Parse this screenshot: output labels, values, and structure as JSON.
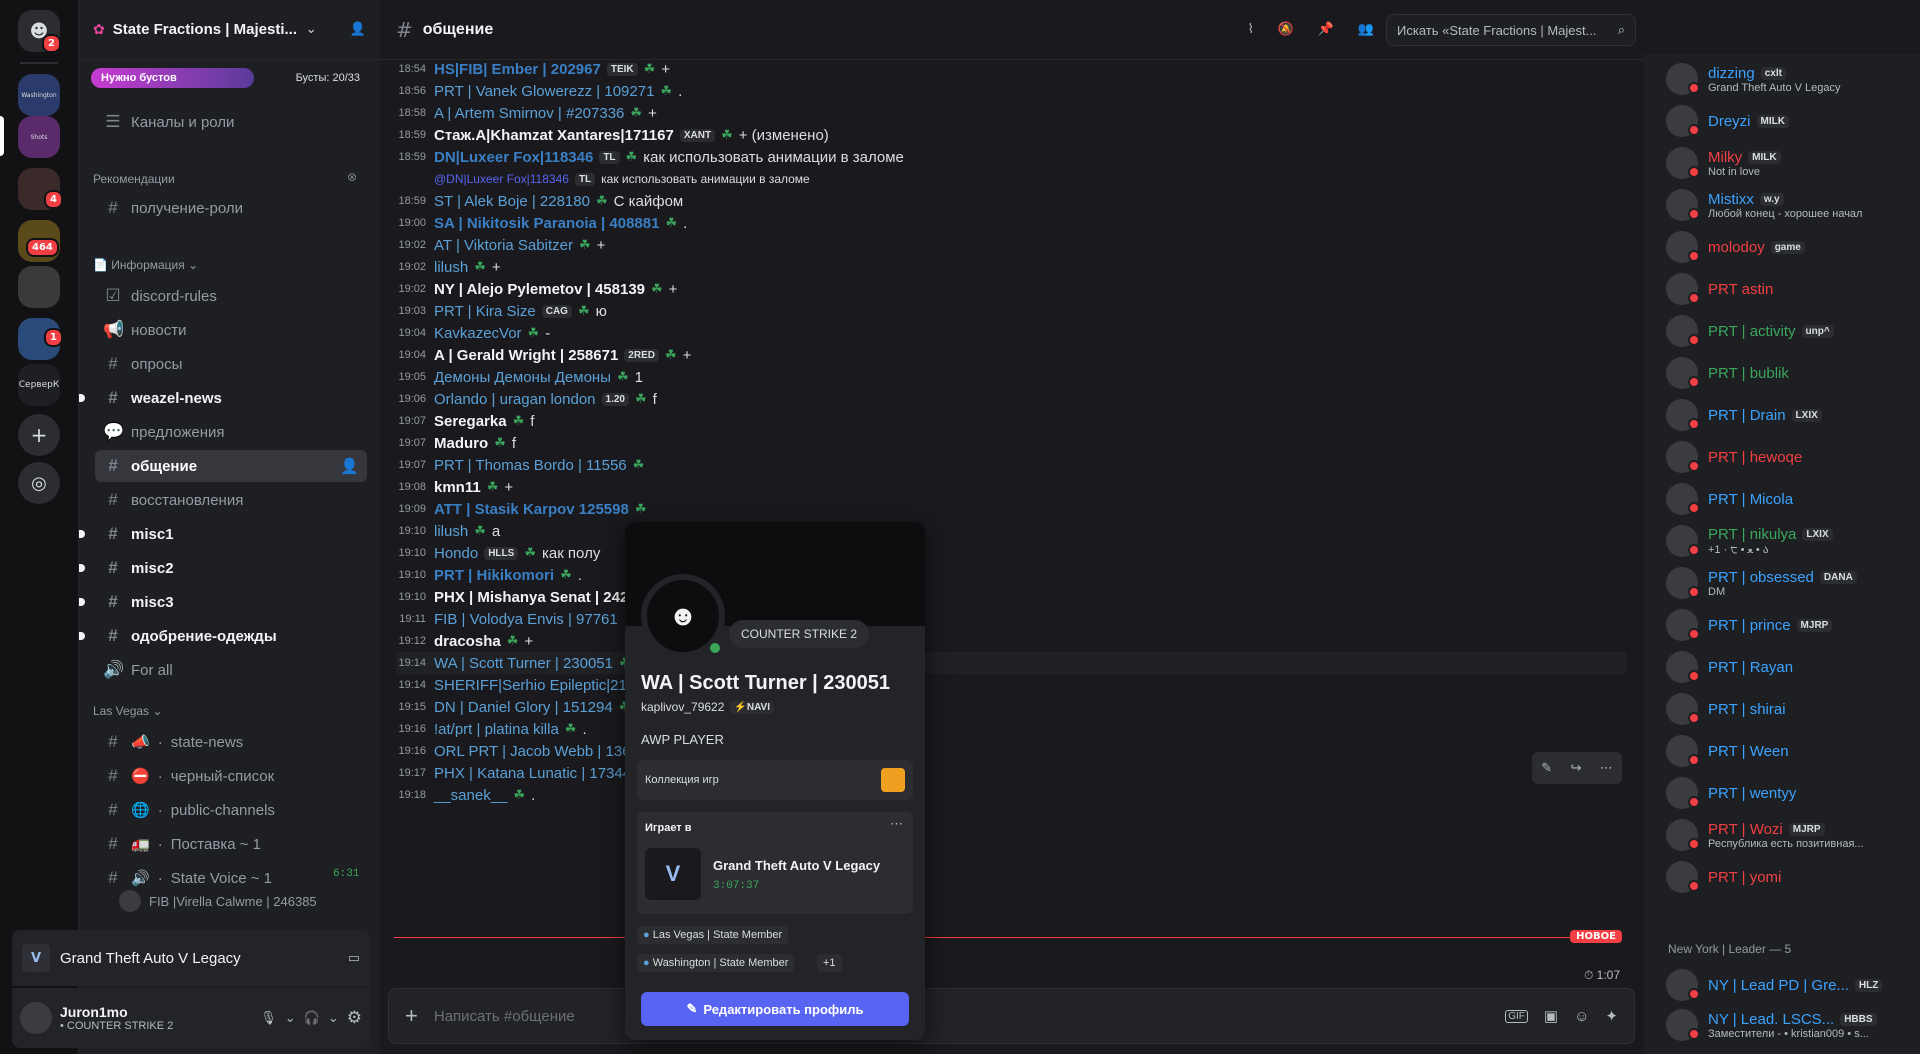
{
  "rail": {
    "home_badge": "2",
    "servers": [
      {
        "label": "Washington",
        "badge": ""
      },
      {
        "label": "Shots",
        "badge": ""
      },
      {
        "label": "",
        "badge": "4"
      },
      {
        "label": "",
        "badge": "464"
      },
      {
        "label": "",
        "badge": ""
      },
      {
        "label": "",
        "badge": "1"
      }
    ],
    "server_text": "СерверК"
  },
  "guild": {
    "name": "State Fractions | Majesti...",
    "boost_label": "Нужно бустов",
    "boost_count": "Бусты: 20/33"
  },
  "channels": {
    "roles": "Каналы и роли",
    "recommend_cat": "Рекомендации",
    "get_role": "получение-роли",
    "info_cat": "Информация",
    "items": [
      {
        "name": "discord-rules",
        "icon": "checkbox-icon",
        "state": "read"
      },
      {
        "name": "новости",
        "icon": "megaphone-icon",
        "state": "read"
      },
      {
        "name": "опросы",
        "icon": "hash-icon",
        "state": "read"
      },
      {
        "name": "weazel-news",
        "icon": "hash-icon",
        "state": "unread"
      },
      {
        "name": "предложения",
        "icon": "forum-icon",
        "state": "read"
      },
      {
        "name": "общение",
        "icon": "hash-icon",
        "state": "active"
      },
      {
        "name": "восстановления",
        "icon": "hash-icon",
        "state": "read"
      },
      {
        "name": "misc1",
        "icon": "hash-icon",
        "state": "unread"
      },
      {
        "name": "misc2",
        "icon": "hash-icon",
        "state": "unread"
      },
      {
        "name": "misc3",
        "icon": "hash-icon",
        "state": "unread"
      },
      {
        "name": "одобрение-одежды",
        "icon": "hash-icon",
        "state": "unread"
      },
      {
        "name": "For all",
        "icon": "speaker-icon",
        "state": "read"
      }
    ],
    "lv_cat": "Las Vegas",
    "lv_items": [
      {
        "name": "state-news",
        "emoji": "📣"
      },
      {
        "name": "черный-список",
        "emoji": "⛔"
      },
      {
        "name": "public-channels",
        "emoji": "🌐"
      },
      {
        "name": "Поставка ~ 1",
        "emoji": "🚛"
      },
      {
        "name": "State Voice ~ 1",
        "emoji": "🔊"
      }
    ],
    "voice_time": "6:31",
    "voice_user": "FIB |Virella Calwme | 246385"
  },
  "activity": {
    "game": "Grand Theft Auto V Legacy"
  },
  "user": {
    "name": "Juron1mo",
    "status": "• COUNTER STRIKE 2"
  },
  "header": {
    "channel": "общение",
    "search_placeholder": "Искать «State Fractions | Majest..."
  },
  "messages": [
    {
      "t": "18:54",
      "n": "HS|FIB| Ember | 202967",
      "tag": "TEIK",
      "x": "+",
      "s": "b"
    },
    {
      "t": "18:56",
      "n": "PRT | Vanek Glowerezz | 109271",
      "tag": "",
      "x": ".",
      "s": ""
    },
    {
      "t": "18:58",
      "n": "A | Artem Smirnov | #207336",
      "tag": "",
      "x": "+",
      "s": ""
    },
    {
      "t": "18:59",
      "n": "Стаж.A|Khamzat Xantares|171167",
      "tag": "XANT",
      "x": "+ (изменено)",
      "s": "w"
    },
    {
      "t": "18:59",
      "n": "DN|Luxeer Fox|118346",
      "tag": "TL",
      "x": "как использовать анимации в заломе",
      "s": "b"
    },
    {
      "t": "",
      "n": "@DN|Luxeer Fox|118346",
      "tag": "TL",
      "x": "как использовать анимации в заломе",
      "s": "r"
    },
    {
      "t": "18:59",
      "n": "ST | Alek Boje | 228180",
      "tag": "",
      "x": "С кайфом",
      "s": ""
    },
    {
      "t": "19:00",
      "n": "SA | Nikitosik Paranoia | 408881",
      "tag": "",
      "x": ".",
      "s": "b"
    },
    {
      "t": "19:02",
      "n": "AT | Viktoria Sabitzer",
      "tag": "",
      "x": "+",
      "s": ""
    },
    {
      "t": "19:02",
      "n": "lilush",
      "tag": "",
      "x": "+",
      "s": ""
    },
    {
      "t": "19:02",
      "n": "NY | Alejo Pylemetov | 458139",
      "tag": "",
      "x": "+",
      "s": "w"
    },
    {
      "t": "19:03",
      "n": "PRT | Kira Size",
      "tag": "CAG",
      "x": "ю",
      "s": ""
    },
    {
      "t": "19:04",
      "n": "KavkazecVor",
      "tag": "",
      "x": "-",
      "s": ""
    },
    {
      "t": "19:04",
      "n": "A | Gerald Wright | 258671",
      "tag": "2RED",
      "x": "+",
      "s": "w"
    },
    {
      "t": "19:05",
      "n": "Демоны Демоны Демоны",
      "tag": "",
      "x": "1",
      "s": ""
    },
    {
      "t": "19:06",
      "n": "Orlando | uragan london",
      "tag": "1.20",
      "x": "f",
      "s": ""
    },
    {
      "t": "19:07",
      "n": "Seregarka",
      "tag": "",
      "x": "f",
      "s": "w"
    },
    {
      "t": "19:07",
      "n": "Maduro",
      "tag": "",
      "x": "f",
      "s": "w"
    },
    {
      "t": "19:07",
      "n": "PRT | Thomas Bordo | 11556",
      "tag": "",
      "x": "",
      "s": ""
    },
    {
      "t": "19:08",
      "n": "kmn11",
      "tag": "",
      "x": "+",
      "s": "w"
    },
    {
      "t": "19:09",
      "n": "ATT | Stasik Karpov 125598",
      "tag": "",
      "x": "",
      "s": "b"
    },
    {
      "t": "19:10",
      "n": "lilush",
      "tag": "",
      "x": "a",
      "s": ""
    },
    {
      "t": "19:10",
      "n": "Hondo",
      "tag": "HLLS",
      "x": "как полу",
      "s": ""
    },
    {
      "t": "19:10",
      "n": "PRT | Hikikomori",
      "tag": "",
      "x": ".",
      "s": "b"
    },
    {
      "t": "19:10",
      "n": "PHX | Mishanya Senat | 2423",
      "tag": "",
      "x": "",
      "s": "w"
    },
    {
      "t": "19:11",
      "n": "FIB | Volodya Envis | 97761",
      "tag": "",
      "x": "+",
      "s": ""
    },
    {
      "t": "19:12",
      "n": "dracosha",
      "tag": "",
      "x": "+",
      "s": "w"
    },
    {
      "t": "19:14",
      "n": "WA | Scott Turner | 230051",
      "tag": "",
      "x": "",
      "s": ""
    },
    {
      "t": "19:14",
      "n": "SHERIFF|Serhio Epileptic|21",
      "tag": "",
      "x": "",
      "s": ""
    },
    {
      "t": "19:15",
      "n": "DN | Daniel Glory | 151294",
      "tag": "",
      "x": "",
      "s": ""
    },
    {
      "t": "19:16",
      "n": "!at/prt | platina killa",
      "tag": "",
      "x": ".",
      "s": ""
    },
    {
      "t": "19:16",
      "n": "ORL PRT | Jacob Webb | 136",
      "tag": "",
      "x": "",
      "s": ""
    },
    {
      "t": "19:17",
      "n": "PHX | Katana Lunatic | 17344",
      "tag": "",
      "x": "",
      "s": ""
    },
    {
      "t": "19:18",
      "n": "__sanek__",
      "tag": "",
      "x": ".",
      "s": ""
    }
  ],
  "new_label": "НОВОЕ",
  "slowmode": "1:07",
  "composer_placeholder": "Написать #общение",
  "profile": {
    "game_bubble": "COUNTER STRIKE 2",
    "name": "WA | Scott Turner | 230051",
    "username": "kaplivov_79622",
    "clan": "NAVI",
    "bio": "AWP PLAYER",
    "collection": "Коллекция игр",
    "playing_label": "Играет в",
    "game": "Grand Theft Auto V Legacy",
    "elapsed": "3:07:37",
    "roles": [
      "Las Vegas | State Member",
      "Washington | State Member"
    ],
    "more_roles": "+1",
    "edit_button": "Редактировать профиль"
  },
  "members": [
    {
      "name": "dizzing",
      "tag": "cxlt",
      "sub": "Grand Theft Auto V Legacy",
      "color": "#3ba3ff"
    },
    {
      "name": "Dreyzi",
      "tag": "MILK",
      "sub": "",
      "color": "#3ba3ff"
    },
    {
      "name": "Milky",
      "tag": "MILK",
      "sub": "Not in love",
      "color": "#f23f43"
    },
    {
      "name": "Mistixx",
      "tag": "w.y",
      "sub": "Любой конец - хорошее начал",
      "color": "#3ba3ff"
    },
    {
      "name": "molodoy",
      "tag": "game",
      "sub": "",
      "color": "#f23f43"
    },
    {
      "name": "PRT astin",
      "tag": "",
      "sub": "",
      "color": "#f23f43"
    },
    {
      "name": "PRT | activity",
      "tag": "unp^",
      "sub": "",
      "color": "#3ba55c"
    },
    {
      "name": "PRT | bublik",
      "tag": "",
      "sub": "",
      "color": "#3ba55c"
    },
    {
      "name": "PRT | Drain",
      "tag": "LXIX",
      "sub": "",
      "color": "#3ba3ff"
    },
    {
      "name": "PRT | hewoqe",
      "tag": "",
      "sub": "",
      "color": "#f23f43"
    },
    {
      "name": "PRT | Micola",
      "tag": "",
      "sub": "",
      "color": "#3ba3ff"
    },
    {
      "name": "PRT | nikulya",
      "tag": "LXIX",
      "sub": "+1 · ੮ • ﻌ • ა",
      "color": "#3ba55c"
    },
    {
      "name": "PRT | obsessed",
      "tag": "DANA",
      "sub": "DM",
      "color": "#3ba3ff"
    },
    {
      "name": "PRT | prince",
      "tag": "MJRP",
      "sub": "",
      "color": "#3ba3ff"
    },
    {
      "name": "PRT | Rayan",
      "tag": "",
      "sub": "",
      "color": "#3ba3ff"
    },
    {
      "name": "PRT | shirai",
      "tag": "",
      "sub": "",
      "color": "#3ba3ff"
    },
    {
      "name": "PRT | Ween",
      "tag": "",
      "sub": "",
      "color": "#3ba3ff"
    },
    {
      "name": "PRT | wentyy",
      "tag": "",
      "sub": "",
      "color": "#3ba3ff"
    },
    {
      "name": "PRT | Wozi",
      "tag": "MJRP",
      "sub": "Республика есть позитивная...",
      "color": "#f23f43"
    },
    {
      "name": "PRT | yomi",
      "tag": "",
      "sub": "",
      "color": "#f23f43"
    }
  ],
  "members_section": "New York | Leader — 5",
  "members_ny": [
    {
      "name": "NY | Lead PD | Gre...",
      "tag": "HLZ",
      "sub": "",
      "color": "#3ba3ff"
    },
    {
      "name": "NY | Lead. LSCS...",
      "tag": "HBBS",
      "sub": "Заместители - • kristian009 • s...",
      "color": "#3ba3ff"
    }
  ]
}
